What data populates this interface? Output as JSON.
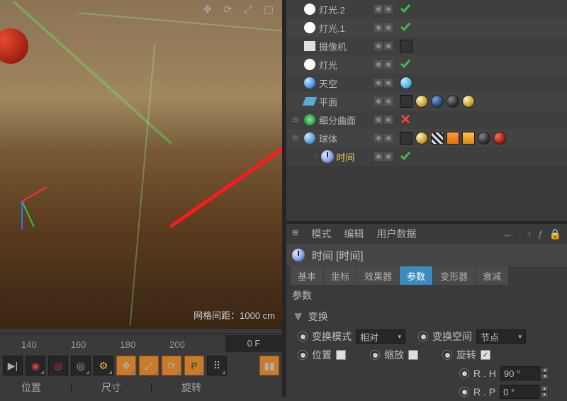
{
  "viewport": {
    "grid_hint": "网格间距：1000 cm"
  },
  "ruler": {
    "ticks": [
      "140",
      "160",
      "180",
      "200"
    ],
    "current": "0 F"
  },
  "bottom_tabs": {
    "a": "位置",
    "b": "尺寸",
    "c": "旋转"
  },
  "objects": [
    {
      "name": "灯光.2",
      "icon": "light",
      "sel": false,
      "check": true,
      "tags": []
    },
    {
      "name": "灯光.1",
      "icon": "light",
      "sel": false,
      "check": true,
      "tags": []
    },
    {
      "name": "摄像机",
      "icon": "cam",
      "sel": false,
      "check": null,
      "tags": [
        "oct"
      ]
    },
    {
      "name": "灯光",
      "icon": "light",
      "sel": false,
      "check": true,
      "tags": []
    },
    {
      "name": "天空",
      "icon": "sky",
      "sel": false,
      "check": null,
      "tags": [
        "cyan"
      ]
    },
    {
      "name": "平面",
      "icon": "plane",
      "sel": false,
      "check": null,
      "tags": [
        "oct",
        "gold",
        "earth",
        "dark",
        "gold"
      ]
    },
    {
      "name": "细分曲面",
      "icon": "subdiv",
      "sel": false,
      "check": false,
      "expand": true,
      "tags": []
    },
    {
      "name": "球体",
      "icon": "sphere",
      "sel": false,
      "check": null,
      "expand": true,
      "tags": [
        "oct",
        "gold",
        "checker",
        "warn",
        "warn2",
        "dark",
        "red"
      ]
    },
    {
      "name": "时间",
      "icon": "time",
      "sel": true,
      "check": true,
      "indent": 1,
      "tags": []
    }
  ],
  "am": {
    "menu": {
      "mode": "模式",
      "edit": "编辑",
      "userdata": "用户数据"
    },
    "title": "时间 [时间]",
    "tabs": [
      "基本",
      "坐标",
      "效果器",
      "参数",
      "变形器",
      "衰减"
    ],
    "active_tab": 3,
    "section": "参数",
    "group": "变换",
    "row1": {
      "mode_label": "变换模式",
      "mode_value": "相对",
      "space_label": "变换空间",
      "space_value": "节点"
    },
    "row2": {
      "pos": "位置",
      "pos_on": false,
      "scale": "缩放",
      "scale_on": false,
      "rot": "旋转",
      "rot_on": true
    },
    "rot_h_label": "R . H",
    "rot_h_value": "90 °",
    "rot_p_label": "R . P",
    "rot_p_value": "0 °"
  }
}
